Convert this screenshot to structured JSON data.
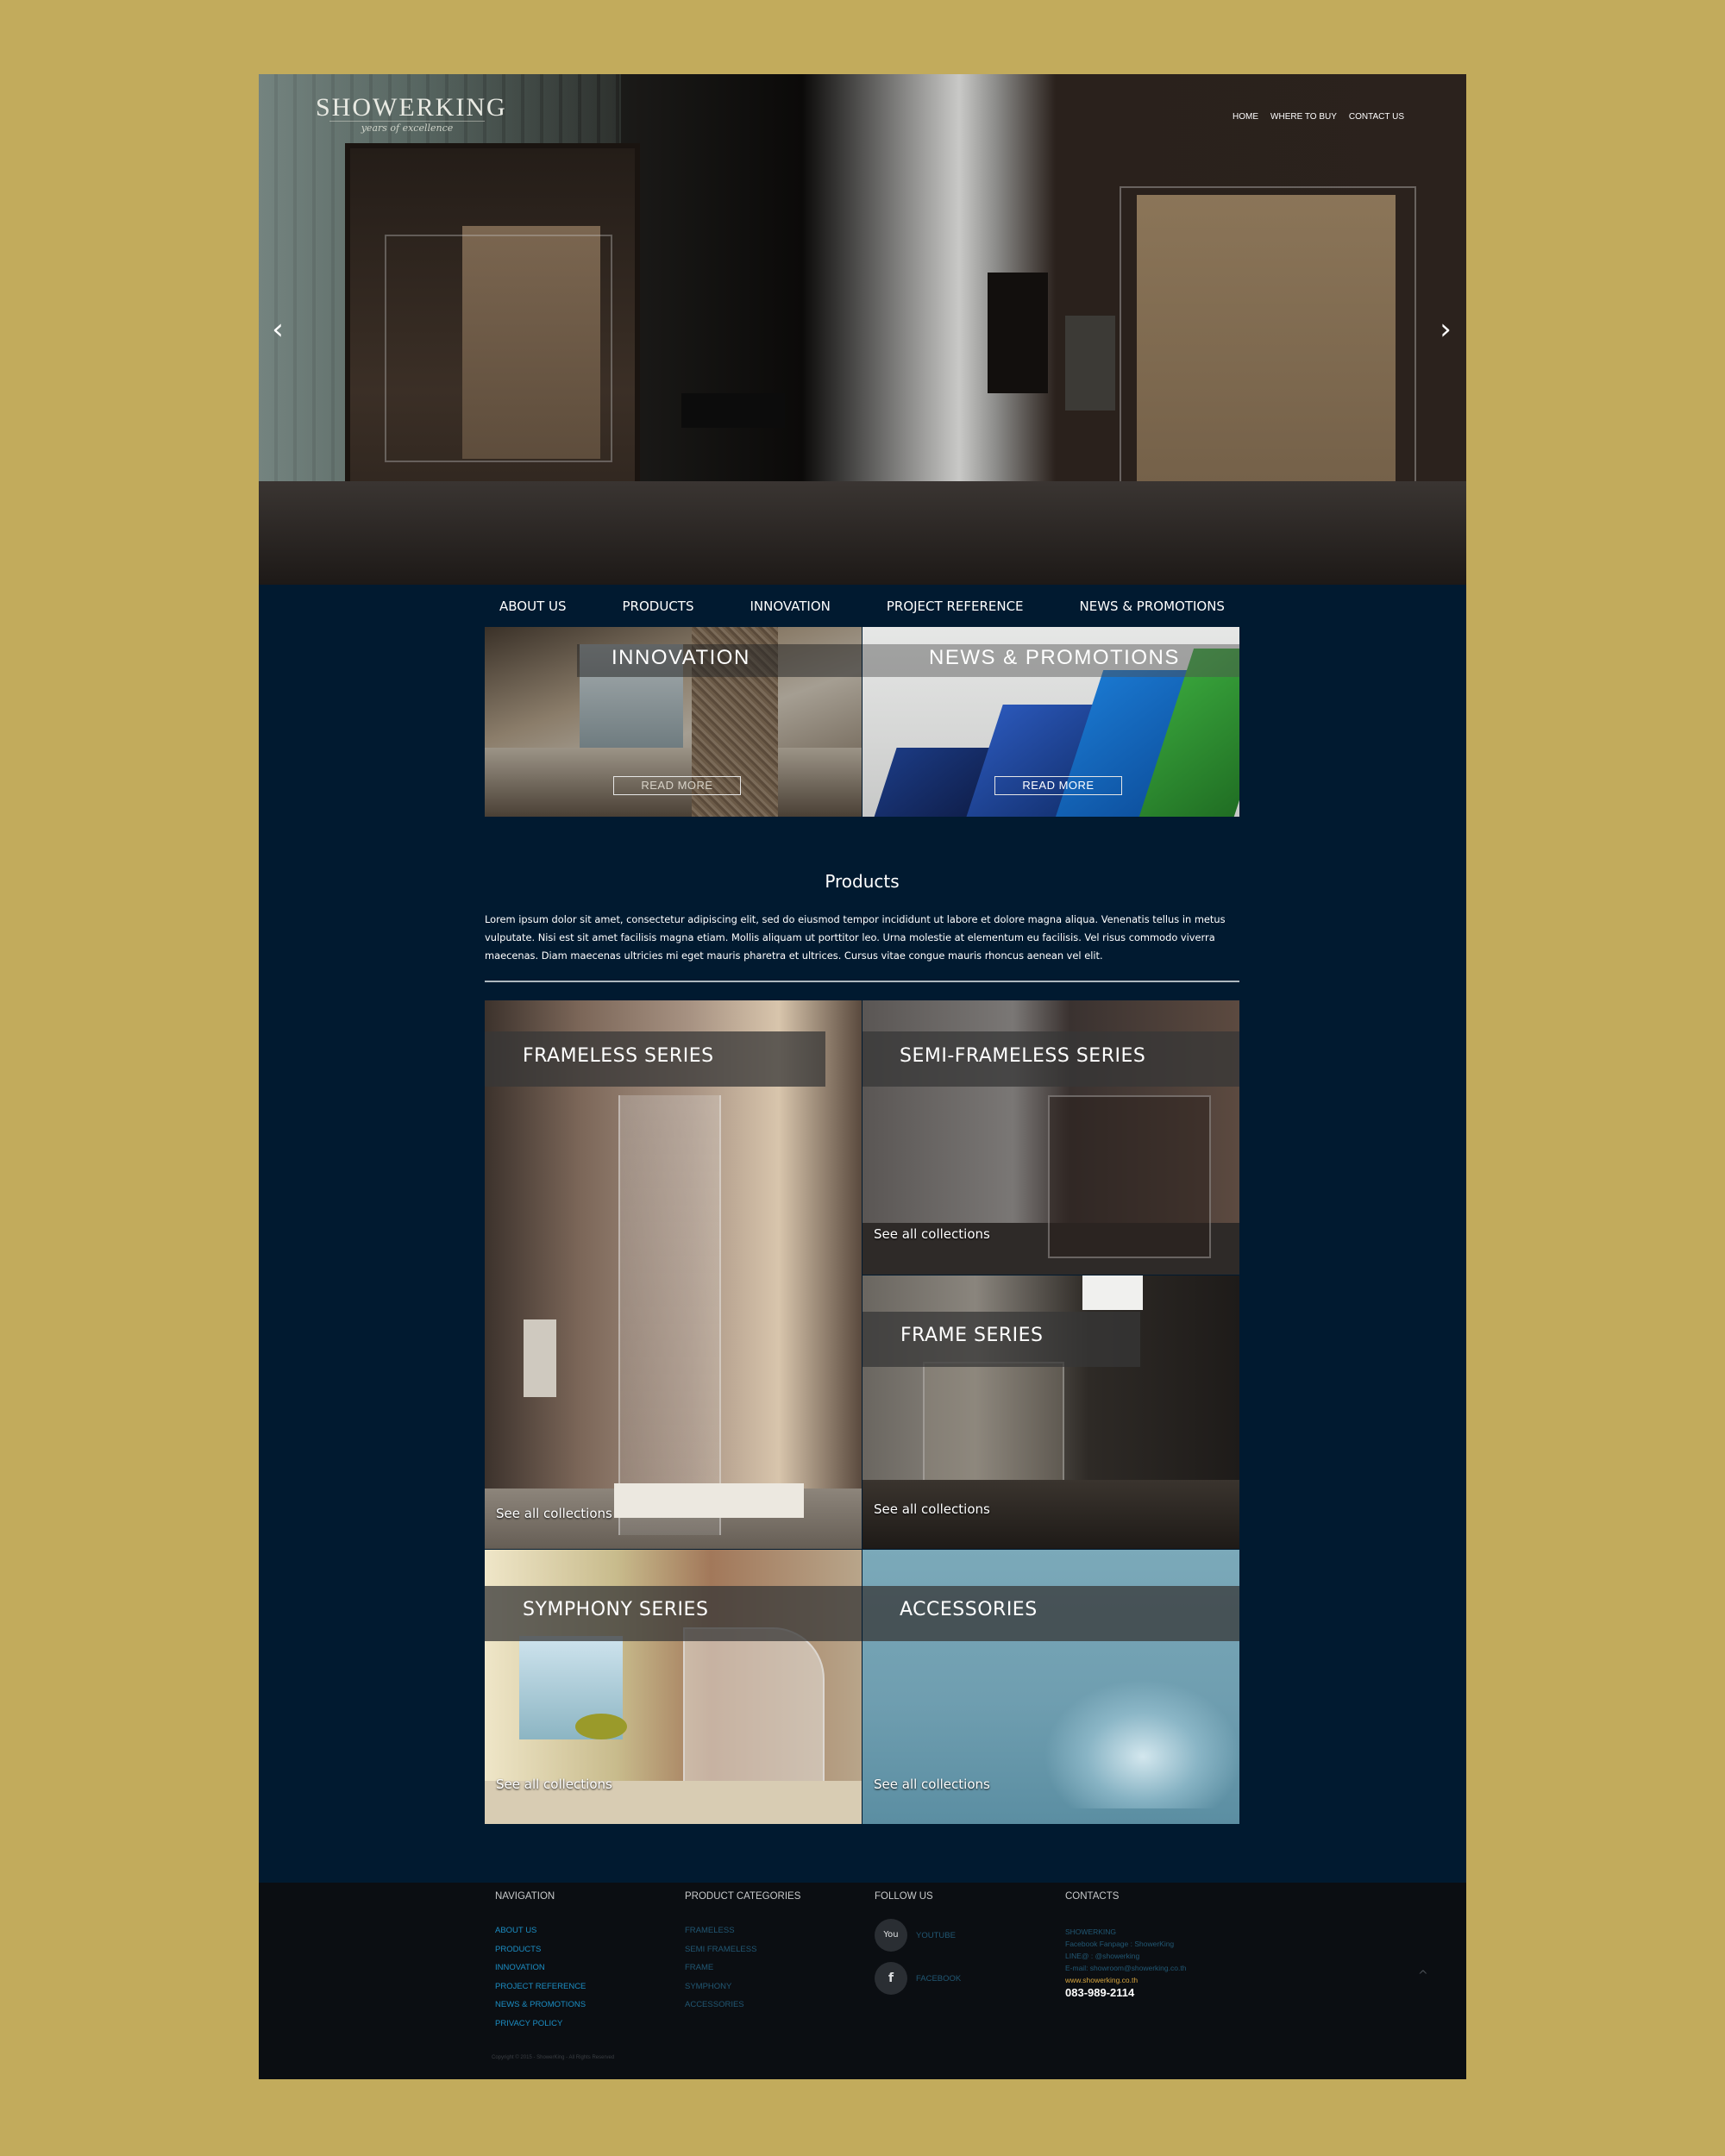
{
  "brand": {
    "name": "SHOWERKING",
    "tagline": "years of excellence"
  },
  "top_nav": [
    "HOME",
    "WHERE TO BUY",
    "CONTACT US"
  ],
  "hero": {
    "prev_icon": "chevron-left",
    "next_icon": "chevron-right"
  },
  "main_nav": [
    "ABOUT US",
    "PRODUCTS",
    "INNOVATION",
    "PROJECT REFERENCE",
    "NEWS & PROMOTIONS"
  ],
  "promos": [
    {
      "title": "INNOVATION",
      "button": "READ MORE"
    },
    {
      "title": "NEWS & PROMOTIONS",
      "button": "READ MORE"
    }
  ],
  "products": {
    "title": "Products",
    "text": "Lorem ipsum dolor sit amet, consectetur adipiscing elit, sed do eiusmod tempor incididunt ut labore et dolore magna aliqua. Venenatis tellus in metus vulputate. Nisi est sit amet facilisis magna etiam. Mollis aliquam ut porttitor leo. Urna molestie at elementum eu facilisis. Vel risus commodo viverra maecenas. Diam maecenas ultricies mi eget mauris pharetra et ultrices. Cursus vitae congue mauris rhoncus aenean vel elit.",
    "see_all": "See all collections",
    "series": [
      {
        "name": "FRAMELESS SERIES"
      },
      {
        "name": "SEMI-FRAMELESS SERIES"
      },
      {
        "name": "FRAME SERIES"
      },
      {
        "name": "SYMPHONY SERIES"
      },
      {
        "name": "ACCESSORIES"
      }
    ]
  },
  "footer": {
    "navigation": {
      "heading": "NAVIGATION",
      "links": [
        "ABOUT US",
        "PRODUCTS",
        "INNOVATION",
        "PROJECT REFERENCE",
        "NEWS & PROMOTIONS",
        "PRIVACY POLICY"
      ]
    },
    "categories": {
      "heading": "PRODUCT CATEGORIES",
      "links": [
        "FRAMELESS",
        "SEMI FRAMELESS",
        "FRAME",
        "SYMPHONY",
        "ACCESSORIES"
      ]
    },
    "follow": {
      "heading": "FOLLOW US",
      "youtube": "YOUTUBE",
      "youtube_icon": "You",
      "facebook": "FACEBOOK",
      "facebook_icon": "f"
    },
    "contacts": {
      "heading": "CONTACTS",
      "lines": [
        "SHOWERKING",
        "Facebook Fanpage : ShowerKing",
        "LINE@ : @showerking",
        "E-mail: showroom@showerking.co.th"
      ],
      "website": "www.showerking.co.th",
      "phone": "083-989-2114"
    },
    "copyright": "Copyright © 2015 - ShowerKing - All Rights Reserved",
    "to_top_icon": "^"
  }
}
